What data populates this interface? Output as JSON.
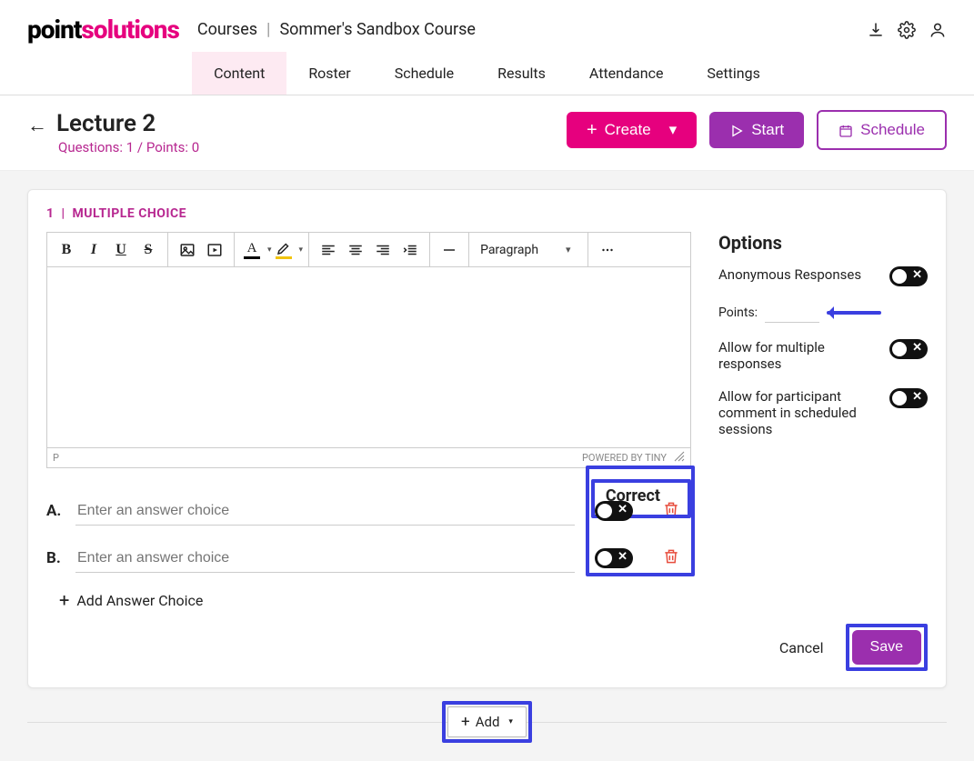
{
  "brand": {
    "point": "point",
    "solutions": "solutions"
  },
  "breadcrumb": {
    "root": "Courses",
    "course": "Sommer's Sandbox Course"
  },
  "nav": {
    "active": "Content",
    "items": [
      "Content",
      "Roster",
      "Schedule",
      "Results",
      "Attendance",
      "Settings"
    ]
  },
  "page": {
    "title": "Lecture 2",
    "subtitle": "Questions: 1 / Points: 0",
    "create_label": "Create",
    "start_label": "Start",
    "schedule_label": "Schedule"
  },
  "question": {
    "index": "1",
    "type": "MULTIPLE CHOICE",
    "editor": {
      "paragraph_label": "Paragraph",
      "path": "P",
      "powered_by": "POWERED BY TINY"
    },
    "correct_header": "Correct",
    "answers": [
      {
        "letter": "A.",
        "placeholder": "Enter an answer choice"
      },
      {
        "letter": "B.",
        "placeholder": "Enter an answer choice"
      }
    ],
    "add_answer_label": "Add Answer Choice"
  },
  "options": {
    "title": "Options",
    "anonymous_label": "Anonymous Responses",
    "points_label": "Points:",
    "points_value": "",
    "multi_label": "Allow for multiple responses",
    "comment_label": "Allow for participant comment in scheduled sessions"
  },
  "footer": {
    "cancel_label": "Cancel",
    "save_label": "Save",
    "add_label": "Add"
  }
}
